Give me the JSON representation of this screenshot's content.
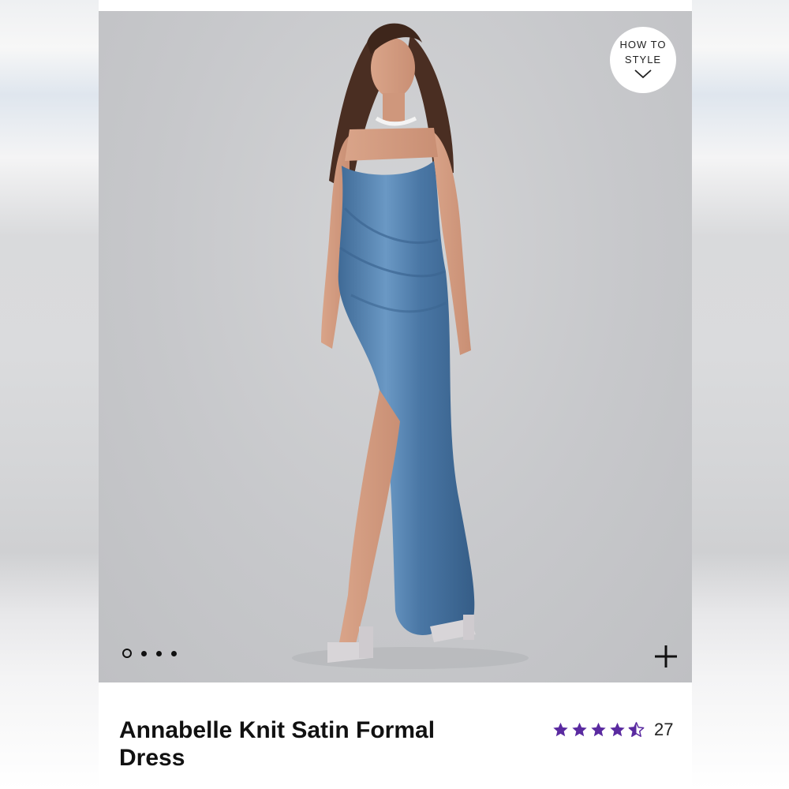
{
  "product": {
    "title": "Annabelle Knit Satin Formal Dress",
    "rating": 4.5,
    "rating_max": 5,
    "review_count": "27"
  },
  "gallery": {
    "how_to_style_line1": "HOW TO",
    "how_to_style_line2": "STYLE",
    "image_count": 4,
    "active_index": 0
  },
  "colors": {
    "star": "#5a2aa0",
    "dress": "#4f7ba8"
  },
  "icons": {
    "how_to_style": "chevron-down-icon",
    "zoom": "plus-icon",
    "rating": "star-icon"
  }
}
